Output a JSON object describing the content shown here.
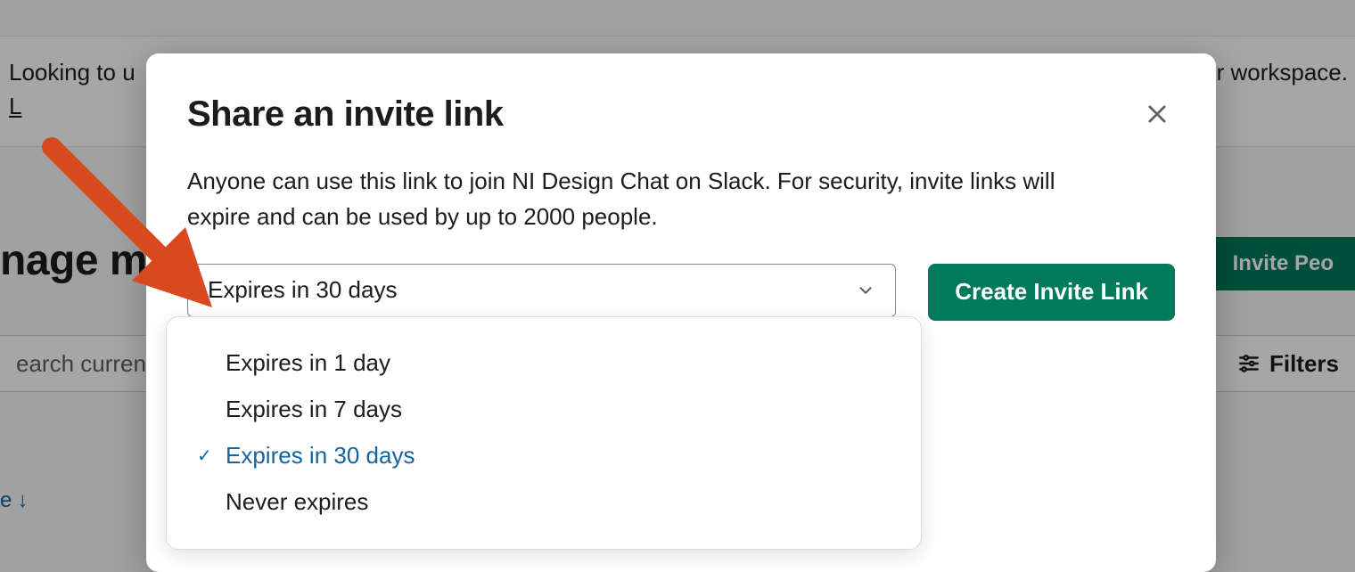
{
  "banner": {
    "text_start": "Looking to u",
    "text_end": "to your workspace.",
    "link_hint": "L"
  },
  "page": {
    "title_fragment": "nage m",
    "invite_button": "Invite Peo",
    "search_placeholder": "earch current",
    "filters_label": "Filters",
    "sort_fragment": "e",
    "sort_arrow": "↓"
  },
  "modal": {
    "title": "Share an invite link",
    "description": "Anyone can use this link to join NI Design Chat on Slack. For security, invite links will expire and can be used by up to 2000 people.",
    "select_value": "Expires in 30 days",
    "options": [
      {
        "label": "Expires in 1 day",
        "selected": false
      },
      {
        "label": "Expires in 7 days",
        "selected": false
      },
      {
        "label": "Expires in 30 days",
        "selected": true
      },
      {
        "label": "Never expires",
        "selected": false
      }
    ],
    "create_button": "Create Invite Link"
  }
}
